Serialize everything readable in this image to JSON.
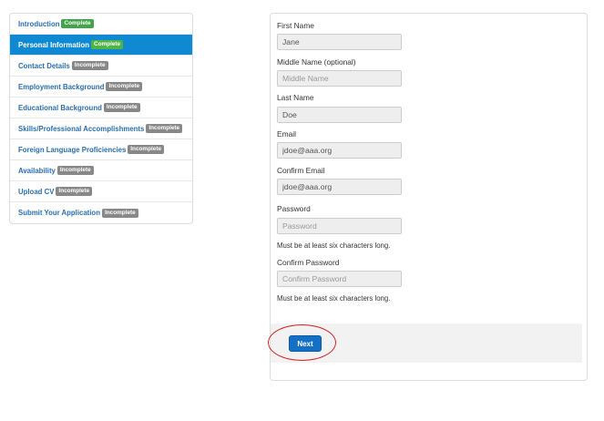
{
  "sidebar": {
    "items": [
      {
        "label": "Introduction",
        "status": "Complete"
      },
      {
        "label": "Personal Information",
        "status": "Complete"
      },
      {
        "label": "Contact Details",
        "status": "Incomplete"
      },
      {
        "label": "Employment Background",
        "status": "Incomplete"
      },
      {
        "label": "Educational Background",
        "status": "Incomplete"
      },
      {
        "label": "Skills/Professional Accomplishments",
        "status": "Incomplete"
      },
      {
        "label": "Foreign Language Proficiencies",
        "status": "Incomplete"
      },
      {
        "label": "Availability",
        "status": "Incomplete"
      },
      {
        "label": "Upload CV",
        "status": "Incomplete"
      },
      {
        "label": "Submit Your Application",
        "status": "Incomplete"
      }
    ],
    "active_index": 1
  },
  "form": {
    "first_name": {
      "label": "First Name",
      "value": "Jane",
      "placeholder": ""
    },
    "middle_name": {
      "label": "Middle Name (optional)",
      "value": "",
      "placeholder": "Middle Name"
    },
    "last_name": {
      "label": "Last Name",
      "value": "Doe",
      "placeholder": ""
    },
    "email": {
      "label": "Email",
      "value": "jdoe@aaa.org",
      "placeholder": ""
    },
    "confirm_email": {
      "label": "Confirm Email",
      "value": "jdoe@aaa.org",
      "placeholder": ""
    },
    "password": {
      "label": "Password",
      "value": "",
      "placeholder": "Password",
      "help": "Must be at least six characters long."
    },
    "confirm_password": {
      "label": "Confirm Password",
      "value": "",
      "placeholder": "Confirm Password",
      "help": "Must be at least six characters long."
    },
    "next_label": "Next"
  },
  "colors": {
    "active_item": "#0f8ad2",
    "complete_badge": "#41a34a",
    "incomplete_badge": "#888888",
    "next_button": "#1370c4",
    "highlight_ring": "#d11f1f"
  }
}
